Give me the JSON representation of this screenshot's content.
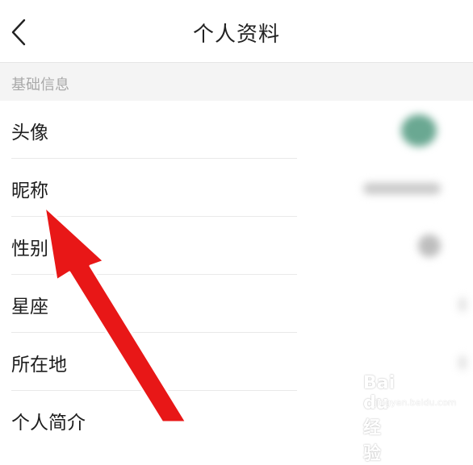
{
  "header": {
    "title": "个人资料",
    "back_icon": "chevron-left-icon"
  },
  "section": {
    "title": "基础信息"
  },
  "rows": [
    {
      "label": "头像"
    },
    {
      "label": "昵称"
    },
    {
      "label": "性别"
    },
    {
      "label": "星座"
    },
    {
      "label": "所在地"
    },
    {
      "label": "个人简介"
    }
  ],
  "colors": {
    "arrow": "#e81717",
    "avatar": "#6aa892",
    "section_bg": "#f4f4f4"
  },
  "watermark": {
    "name": "Bai du 经验",
    "sub": "jingyan.baidu.com"
  }
}
